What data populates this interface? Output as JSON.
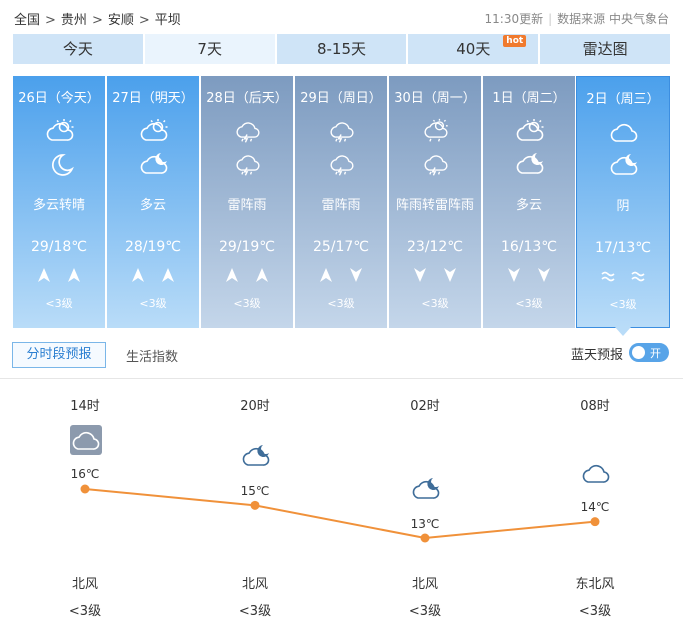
{
  "breadcrumb": [
    "全国",
    "贵州",
    "安顺",
    "平坝"
  ],
  "breadcrumb_sep": ">",
  "update_time": "11:30更新",
  "source": "数据来源 中央气象台",
  "tabs": [
    {
      "label": "今天"
    },
    {
      "label": "7天",
      "active": true
    },
    {
      "label": "8-15天"
    },
    {
      "label": "40天",
      "badge": "hot"
    },
    {
      "label": "雷达图"
    }
  ],
  "days": [
    {
      "date": "26日（今天）",
      "icon_day": "partly-sunny-icon",
      "icon_night": "moon-icon",
      "weather": "多云转晴",
      "temp": "29/18℃",
      "wind_icon": "wind-north-icon",
      "level": "<3级",
      "color": "#4ba0ec"
    },
    {
      "date": "27日（明天）",
      "icon_day": "partly-sunny-icon",
      "icon_night": "cloudy-night-icon",
      "weather": "多云",
      "temp": "28/19℃",
      "wind_icon": "wind-north-icon",
      "level": "<3级",
      "color": "#4ba0ec"
    },
    {
      "date": "28日（后天）",
      "icon_day": "thunderstorm-icon",
      "icon_night": "thunderstorm-icon",
      "weather": "雷阵雨",
      "temp": "29/19℃",
      "wind_icon": "wind-north-icon",
      "level": "<3级",
      "color": "#7d9bc0"
    },
    {
      "date": "29日（周日）",
      "icon_day": "thunderstorm-icon",
      "icon_night": "thunderstorm-icon",
      "weather": "雷阵雨",
      "temp": "25/17℃",
      "wind_icon": "wind-mixed-icon",
      "level": "<3级",
      "color": "#7d9bc0"
    },
    {
      "date": "30日（周一）",
      "icon_day": "sunny-shower-icon",
      "icon_night": "thunderstorm-icon",
      "weather": "阵雨转雷阵雨",
      "temp": "23/12℃",
      "wind_icon": "wind-south-icon",
      "level": "<3级",
      "color": "#7d9bc0"
    },
    {
      "date": "1日（周二）",
      "icon_day": "partly-sunny-icon",
      "icon_night": "cloudy-night-icon",
      "weather": "多云",
      "temp": "16/13℃",
      "wind_icon": "wind-south-icon",
      "level": "<3级",
      "color": "#7d9bc0"
    },
    {
      "date": "2日（周三）",
      "icon_day": "overcast-icon",
      "icon_night": "cloudy-night-icon",
      "weather": "阴",
      "temp": "17/13℃",
      "wind_icon": "wind-wave-icon",
      "level": "<3级",
      "color": "#4ba0ec",
      "selected": true
    }
  ],
  "subtabs": [
    "分时段预报",
    "生活指数"
  ],
  "blue_sky": {
    "label": "蓝天预报",
    "toggle": "开"
  },
  "hourly": [
    {
      "time": "14时",
      "icon": "overcast-icon",
      "temp": "16℃",
      "value": 16,
      "wind": "北风",
      "level": "<3级"
    },
    {
      "time": "20时",
      "icon": "cloudy-night-icon",
      "temp": "15℃",
      "value": 15,
      "wind": "北风",
      "level": "<3级"
    },
    {
      "time": "02时",
      "icon": "cloudy-night-icon",
      "temp": "13℃",
      "value": 13,
      "wind": "北风",
      "level": "<3级"
    },
    {
      "time": "08时",
      "icon": "overcast-icon",
      "temp": "14℃",
      "value": 14,
      "wind": "东北风",
      "level": "<3级"
    }
  ],
  "colors": {
    "accent": "#4ba0ec",
    "line": "#f0913a",
    "tab": "#cfe4f7"
  }
}
